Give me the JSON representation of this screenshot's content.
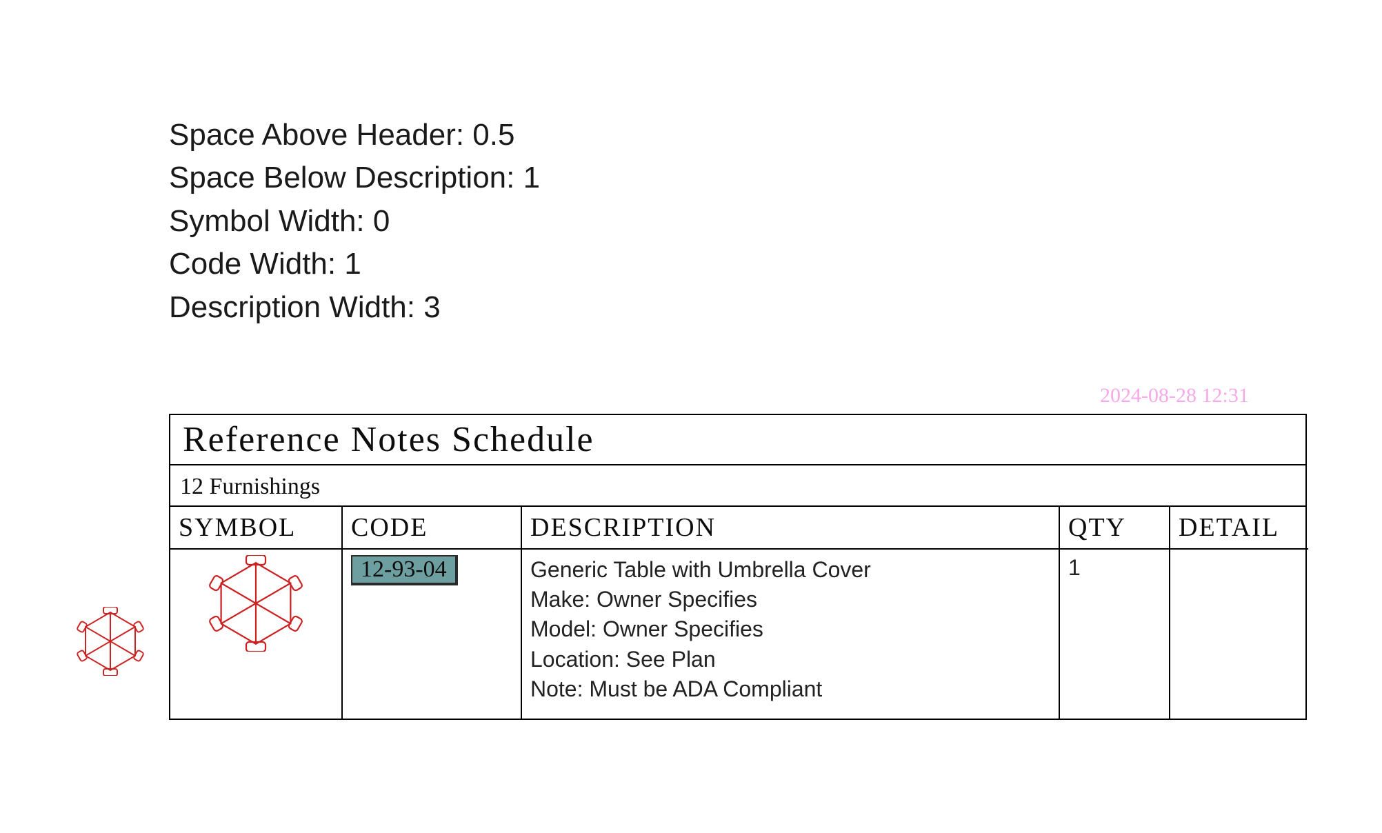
{
  "params": {
    "line1": "Space Above Header: 0.5",
    "line2": "Space Below Description: 1",
    "line3": "Symbol Width: 0",
    "line4": "Code Width: 1",
    "line5": "Description Width: 3"
  },
  "timestamp": "2024-08-28 12:31",
  "schedule": {
    "title": "Reference Notes Schedule",
    "category": "12 Furnishings",
    "headers": {
      "symbol": "SYMBOL",
      "code": "CODE",
      "description": "DESCRIPTION",
      "qty": "QTY",
      "detail": "DETAIL"
    },
    "row": {
      "code": "12-93-04",
      "desc_title": "Generic Table with Umbrella Cover",
      "desc_make": "Make: Owner Specifies",
      "desc_model": "Model: Owner Specifies",
      "desc_location": "Location: See Plan",
      "desc_note": "Note: Must be ADA Compliant",
      "qty": "1",
      "detail": ""
    }
  }
}
